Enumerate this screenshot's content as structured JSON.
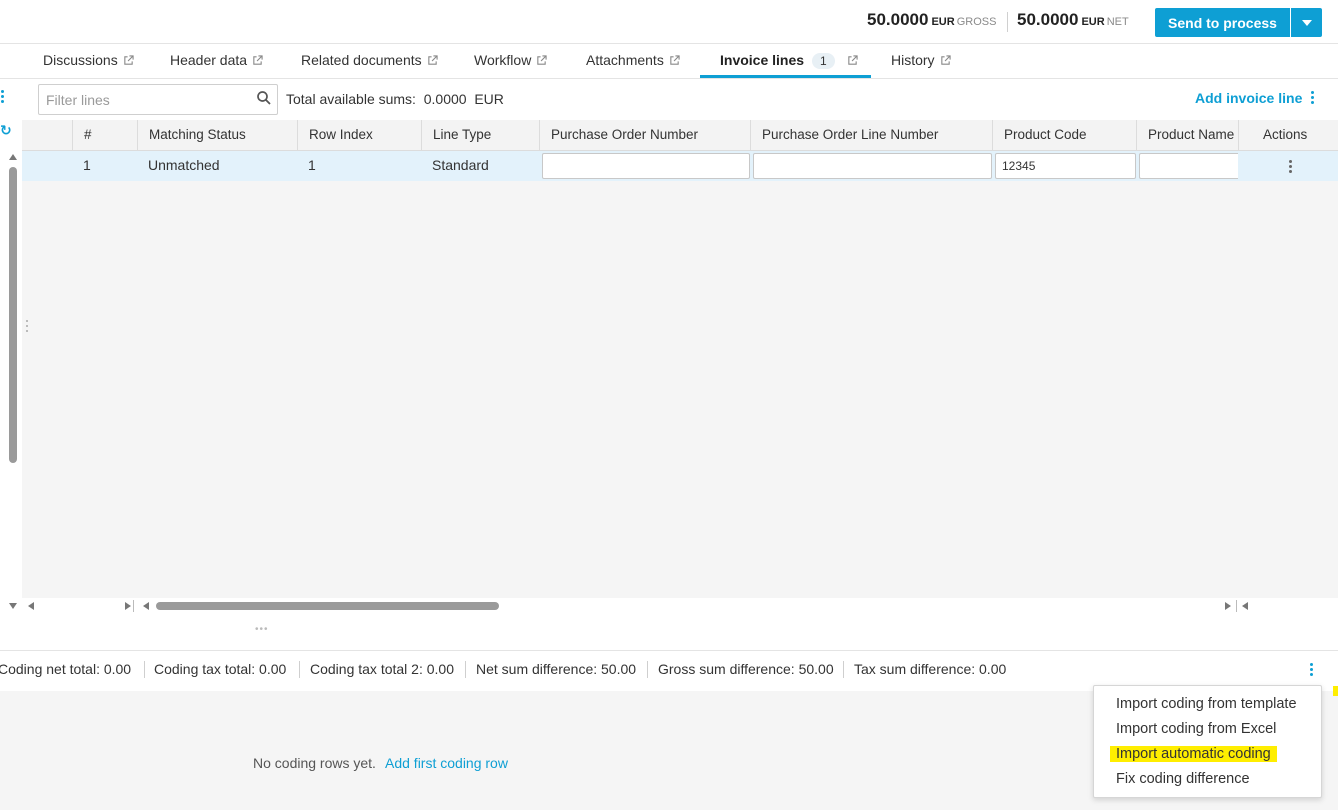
{
  "header": {
    "gross_amount": "50.0000",
    "gross_currency": "EUR",
    "gross_label": "GROSS",
    "net_amount": "50.0000",
    "net_currency": "EUR",
    "net_label": "NET",
    "send_button": "Send to process"
  },
  "tabs": [
    {
      "label": "Discussions"
    },
    {
      "label": "Header data"
    },
    {
      "label": "Related documents"
    },
    {
      "label": "Workflow"
    },
    {
      "label": "Attachments"
    },
    {
      "label": "Invoice lines",
      "badge": "1",
      "active": true
    },
    {
      "label": "History"
    }
  ],
  "toolbar": {
    "filter_placeholder": "Filter lines",
    "totals_label": "Total available sums:",
    "totals_value": "0.0000",
    "totals_currency": "EUR",
    "add_line": "Add invoice line"
  },
  "grid": {
    "columns": [
      "#",
      "Matching Status",
      "Row Index",
      "Line Type",
      "Purchase Order Number",
      "Purchase Order Line Number",
      "Product Code",
      "Product Name",
      "Actions"
    ],
    "rows": [
      {
        "num": "1",
        "matching_status": "Unmatched",
        "row_index": "1",
        "line_type": "Standard",
        "po_number": "",
        "po_line_number": "",
        "product_code": "12345",
        "product_name": ""
      }
    ]
  },
  "coding_summary": [
    "Coding net total: 0.00",
    "Coding tax total: 0.00",
    "Coding tax total 2: 0.00",
    "Net sum difference: 50.00",
    "Gross sum difference: 50.00",
    "Tax sum difference: 0.00"
  ],
  "coding": {
    "empty_text": "No coding rows yet.",
    "add_first": "Add first coding row"
  },
  "menu": {
    "items": [
      {
        "label": "Import coding from template"
      },
      {
        "label": "Import coding from Excel"
      },
      {
        "label": "Import automatic coding",
        "highlighted": true
      },
      {
        "label": "Fix coding difference"
      }
    ]
  },
  "colors": {
    "accent": "#0e9fd4",
    "selected_row": "#e3f2fb",
    "highlight": "#ffee00"
  }
}
